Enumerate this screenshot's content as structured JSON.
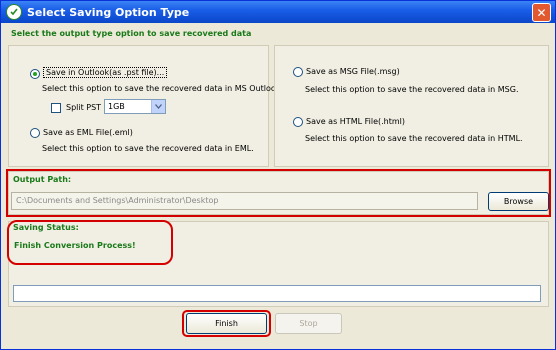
{
  "window": {
    "title": "Select Saving Option Type"
  },
  "heading": "Select the output type option to save recovered data",
  "options": {
    "pst": {
      "label": "Save in Outlook(as .pst file)...",
      "desc": "Select this option to save the recovered data in MS Outlook.",
      "checked": true
    },
    "split": {
      "label": "Split PST",
      "size": "1GB"
    },
    "eml": {
      "label": "Save as EML File(.eml)",
      "desc": "Select this option to save the recovered data in EML."
    },
    "msg": {
      "label": "Save as MSG File(.msg)",
      "desc": "Select this option to save the recovered data in MSG."
    },
    "html": {
      "label": "Save as HTML File(.html)",
      "desc": "Select this option to save the recovered data in HTML."
    }
  },
  "output": {
    "title": "Output Path:",
    "path": "C:\\Documents and Settings\\Administrator\\Desktop",
    "browse": "Browse"
  },
  "status": {
    "title": "Saving Status:",
    "message": "Finish Conversion Process!"
  },
  "buttons": {
    "finish": "Finish",
    "stop": "Stop"
  },
  "colors": {
    "accent_green": "#1a7a1a",
    "highlight_red": "#d40000",
    "title_blue": "#0a46c8"
  }
}
